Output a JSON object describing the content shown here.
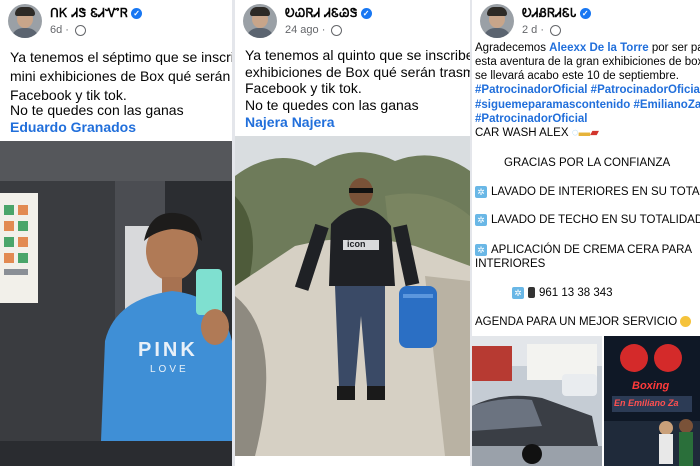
{
  "post1": {
    "username": "ᑎᏦ ᏗᏕ ᏋᏗᏉᏒ",
    "time": "6d",
    "lines": [
      "Ya tenemos el séptimo  que se inscri",
      "mini exhibiciones de Box qué serán t",
      "Facebook y  tik tok.",
      "No te quedes con las ganas"
    ],
    "tag": "Eduardo Granados"
  },
  "post2": {
    "username": "ᎧᏇᏒᏗ ᏗᏋᏊᏕ",
    "time": "24 ago",
    "lines": [
      "Ya tenemos al quinto que se inscribe p",
      "exhibiciones de Box qué serán trasmiti",
      "Facebook y  tik tok.",
      "No te quedes con las ganas"
    ],
    "tag": "Najera Najera",
    "shirt_brand": "icon"
  },
  "post3": {
    "username": "ᎧᏗᏰᏒᏗᏋᏓ",
    "time": "2 d",
    "line1_pre": "Agradecemos",
    "line1_name": "Aleexx De la Torre",
    "line1_post": "por ser part",
    "line2": "esta aventura de la gran exhibiciones de box",
    "line3": "se llevará acabo este 10 de septiembre.",
    "hashtags1": "#PatrocinadorOficial #PatrocinadorOficial",
    "hashtags2": "#siguemeparamascontenido #EmilianoZapa",
    "hashtags3": "#PatrocinadorOficial",
    "carwash": "CAR WASH ALEX",
    "thanks": "GRACIAS POR LA CONFIANZA",
    "service1": "LAVADO DE INTERIORES EN SU TOTALIDA",
    "service2": "LAVADO DE TECHO EN SU TOTALIDAD",
    "service3a": "APLICACIÓN DE CREMA CERA PARA",
    "service3b": "INTERIORES",
    "phone": "961 13 38 343",
    "agenda": "AGENDA PARA UN MEJOR SERVICIO",
    "poster_title": "Boxing",
    "poster_sub": "En Emiliano Za"
  },
  "photo1": {
    "shirt_text": "PINK",
    "shirt_sub": "LOVE"
  },
  "colors": {
    "link": "#216fdb",
    "meta": "#65676b",
    "verified": "#1877f2"
  }
}
